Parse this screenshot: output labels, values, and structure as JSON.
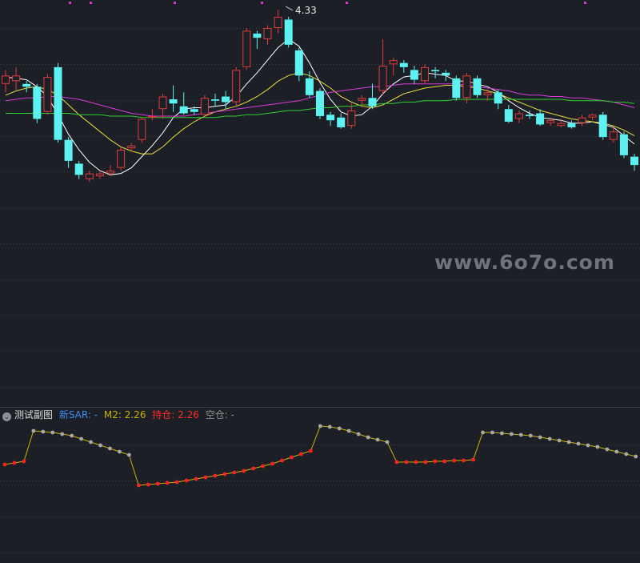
{
  "chart_data": [
    {
      "type": "candlestick",
      "annotation": "4.33",
      "candles": [
        [
          3.8,
          3.86,
          3.74,
          3.9
        ],
        [
          3.82,
          3.86,
          3.76,
          3.92
        ],
        [
          3.8,
          3.78,
          3.74,
          3.82
        ],
        [
          3.78,
          3.55,
          3.52,
          3.8
        ],
        [
          3.6,
          3.85,
          3.58,
          3.87
        ],
        [
          3.92,
          3.4,
          3.38,
          3.95
        ],
        [
          3.4,
          3.25,
          3.2,
          3.42
        ],
        [
          3.23,
          3.15,
          3.12,
          3.25
        ],
        [
          3.12,
          3.16,
          3.1,
          3.18
        ],
        [
          3.14,
          3.16,
          3.12,
          3.18
        ],
        [
          3.16,
          3.18,
          3.14,
          3.22
        ],
        [
          3.2,
          3.33,
          3.18,
          3.35
        ],
        [
          3.34,
          3.36,
          3.32,
          3.38
        ],
        [
          3.4,
          3.55,
          3.38,
          3.56
        ],
        [
          3.56,
          3.57,
          3.54,
          3.62
        ],
        [
          3.62,
          3.71,
          3.55,
          3.73
        ],
        [
          3.69,
          3.66,
          3.6,
          3.79
        ],
        [
          3.64,
          3.59,
          3.58,
          3.74
        ],
        [
          3.62,
          3.6,
          3.58,
          3.64
        ],
        [
          3.58,
          3.7,
          3.56,
          3.72
        ],
        [
          3.69,
          3.68,
          3.64,
          3.73
        ],
        [
          3.71,
          3.67,
          3.62,
          3.75
        ],
        [
          3.67,
          3.9,
          3.64,
          3.92
        ],
        [
          3.92,
          4.18,
          3.9,
          4.2
        ],
        [
          4.16,
          4.13,
          4.05,
          4.18
        ],
        [
          4.12,
          4.2,
          4.08,
          4.22
        ],
        [
          4.2,
          4.28,
          4.16,
          4.33
        ],
        [
          4.26,
          4.08,
          4.06,
          4.28
        ],
        [
          4.04,
          3.86,
          3.82,
          4.06
        ],
        [
          3.84,
          3.72,
          3.7,
          3.89
        ],
        [
          3.75,
          3.57,
          3.55,
          3.77
        ],
        [
          3.58,
          3.54,
          3.5,
          3.6
        ],
        [
          3.56,
          3.49,
          3.48,
          3.59
        ],
        [
          3.5,
          3.61,
          3.48,
          3.66
        ],
        [
          3.68,
          3.7,
          3.64,
          3.72
        ],
        [
          3.7,
          3.64,
          3.62,
          3.8
        ],
        [
          3.75,
          3.93,
          3.72,
          4.12
        ],
        [
          3.94,
          3.97,
          3.86,
          3.99
        ],
        [
          3.95,
          3.92,
          3.88,
          3.97
        ],
        [
          3.9,
          3.83,
          3.8,
          3.93
        ],
        [
          3.82,
          3.92,
          3.8,
          3.94
        ],
        [
          3.9,
          3.89,
          3.84,
          3.92
        ],
        [
          3.88,
          3.86,
          3.82,
          3.9
        ],
        [
          3.84,
          3.7,
          3.68,
          3.86
        ],
        [
          3.7,
          3.86,
          3.66,
          3.88
        ],
        [
          3.84,
          3.72,
          3.7,
          3.86
        ],
        [
          3.72,
          3.74,
          3.68,
          3.76
        ],
        [
          3.74,
          3.66,
          3.62,
          3.76
        ],
        [
          3.62,
          3.53,
          3.52,
          3.65
        ],
        [
          3.55,
          3.59,
          3.52,
          3.61
        ],
        [
          3.58,
          3.57,
          3.55,
          3.61
        ],
        [
          3.59,
          3.51,
          3.5,
          3.62
        ],
        [
          3.52,
          3.54,
          3.5,
          3.56
        ],
        [
          3.5,
          3.52,
          3.49,
          3.55
        ],
        [
          3.52,
          3.49,
          3.48,
          3.54
        ],
        [
          3.52,
          3.56,
          3.5,
          3.58
        ],
        [
          3.56,
          3.58,
          3.54,
          3.59
        ],
        [
          3.58,
          3.42,
          3.4,
          3.6
        ],
        [
          3.4,
          3.46,
          3.38,
          3.49
        ],
        [
          3.44,
          3.29,
          3.27,
          3.46
        ],
        [
          3.28,
          3.22,
          3.18,
          3.3
        ]
      ],
      "ma": [
        {
          "color": "#ffffff",
          "values": [
            3.85,
            3.84,
            3.83,
            3.78,
            3.71,
            3.58,
            3.44,
            3.33,
            3.24,
            3.18,
            3.15,
            3.16,
            3.2,
            3.28,
            3.36,
            3.45,
            3.56,
            3.62,
            3.63,
            3.63,
            3.64,
            3.65,
            3.71,
            3.8,
            3.88,
            3.97,
            4.06,
            4.12,
            4.07,
            3.95,
            3.81,
            3.69,
            3.6,
            3.57,
            3.58,
            3.64,
            3.73,
            3.8,
            3.85,
            3.86,
            3.88,
            3.87,
            3.86,
            3.82,
            3.82,
            3.8,
            3.78,
            3.74,
            3.68,
            3.63,
            3.59,
            3.56,
            3.55,
            3.54,
            3.52,
            3.52,
            3.53,
            3.51,
            3.49,
            3.43,
            3.37
          ]
        },
        {
          "color": "#e6dc3c",
          "values": [
            3.72,
            3.75,
            3.77,
            3.78,
            3.76,
            3.72,
            3.65,
            3.58,
            3.52,
            3.46,
            3.4,
            3.35,
            3.32,
            3.3,
            3.3,
            3.35,
            3.42,
            3.48,
            3.53,
            3.57,
            3.6,
            3.62,
            3.64,
            3.67,
            3.71,
            3.76,
            3.82,
            3.86,
            3.88,
            3.86,
            3.82,
            3.77,
            3.71,
            3.67,
            3.64,
            3.63,
            3.65,
            3.69,
            3.73,
            3.75,
            3.77,
            3.78,
            3.79,
            3.79,
            3.78,
            3.77,
            3.75,
            3.73,
            3.7,
            3.67,
            3.64,
            3.61,
            3.59,
            3.57,
            3.55,
            3.54,
            3.53,
            3.52,
            3.5,
            3.47,
            3.43
          ]
        },
        {
          "color": "#d83ad8",
          "values": [
            3.68,
            3.69,
            3.7,
            3.7,
            3.71,
            3.71,
            3.7,
            3.69,
            3.67,
            3.65,
            3.63,
            3.61,
            3.59,
            3.58,
            3.57,
            3.57,
            3.57,
            3.57,
            3.58,
            3.59,
            3.6,
            3.61,
            3.62,
            3.63,
            3.64,
            3.65,
            3.66,
            3.67,
            3.68,
            3.7,
            3.72,
            3.74,
            3.75,
            3.76,
            3.77,
            3.78,
            3.78,
            3.79,
            3.8,
            3.8,
            3.8,
            3.8,
            3.8,
            3.8,
            3.79,
            3.78,
            3.77,
            3.76,
            3.75,
            3.73,
            3.72,
            3.72,
            3.71,
            3.71,
            3.7,
            3.7,
            3.69,
            3.68,
            3.67,
            3.65,
            3.63
          ]
        },
        {
          "color": "#2fcf2f",
          "values": [
            3.59,
            3.59,
            3.59,
            3.59,
            3.59,
            3.59,
            3.59,
            3.58,
            3.58,
            3.58,
            3.57,
            3.57,
            3.57,
            3.56,
            3.56,
            3.56,
            3.56,
            3.56,
            3.56,
            3.56,
            3.56,
            3.57,
            3.57,
            3.58,
            3.58,
            3.59,
            3.6,
            3.61,
            3.61,
            3.62,
            3.63,
            3.63,
            3.64,
            3.64,
            3.65,
            3.65,
            3.66,
            3.66,
            3.67,
            3.67,
            3.68,
            3.68,
            3.68,
            3.69,
            3.69,
            3.69,
            3.69,
            3.69,
            3.69,
            3.69,
            3.69,
            3.69,
            3.69,
            3.69,
            3.68,
            3.68,
            3.68,
            3.68,
            3.67,
            3.67,
            3.66
          ]
        }
      ]
    },
    {
      "type": "line",
      "values": [
        3.6,
        3.62,
        3.64,
        4.02,
        4.01,
        4.0,
        3.98,
        3.96,
        3.92,
        3.88,
        3.84,
        3.8,
        3.76,
        3.72,
        3.34,
        3.35,
        3.36,
        3.37,
        3.38,
        3.4,
        3.42,
        3.44,
        3.46,
        3.48,
        3.5,
        3.52,
        3.55,
        3.58,
        3.61,
        3.65,
        3.69,
        3.73,
        3.77,
        4.08,
        4.07,
        4.05,
        4.02,
        3.98,
        3.94,
        3.91,
        3.88,
        3.63,
        3.63,
        3.63,
        3.63,
        3.64,
        3.64,
        3.65,
        3.65,
        3.66,
        4.0,
        4.0,
        3.99,
        3.98,
        3.97,
        3.96,
        3.94,
        3.92,
        3.9,
        3.88,
        3.86,
        3.84,
        3.82,
        3.79,
        3.76,
        3.73,
        3.7
      ],
      "signal": [
        "red",
        "red",
        "red",
        "gray",
        "gray",
        "gray",
        "gray",
        "gray",
        "gray",
        "gray",
        "gray",
        "gray",
        "gray",
        "gray",
        "red",
        "red",
        "red",
        "red",
        "red",
        "red",
        "red",
        "red",
        "red",
        "red",
        "red",
        "red",
        "red",
        "red",
        "red",
        "red",
        "red",
        "red",
        "red",
        "gray",
        "gray",
        "gray",
        "gray",
        "gray",
        "gray",
        "gray",
        "gray",
        "red",
        "red",
        "red",
        "red",
        "red",
        "red",
        "red",
        "red",
        "red",
        "gray",
        "gray",
        "gray",
        "gray",
        "gray",
        "gray",
        "gray",
        "gray",
        "gray",
        "gray",
        "gray",
        "gray",
        "gray",
        "gray",
        "gray",
        "gray",
        "gray"
      ]
    }
  ],
  "sub_panel": {
    "name": "测试副图",
    "sar_label": "新SAR: -",
    "m2_label": "M2: 2.26",
    "hold_label": "持仓: 2.26",
    "empty_label": "空仓: -"
  },
  "watermark": "www.6o7o.com",
  "colors": {
    "background": "#1c1f26",
    "up": "#e03c3c",
    "down": "#5cf2f2",
    "grid": "#3a3f4a",
    "sar_red": "#ff2020",
    "sar_gray": "#a8a8a8",
    "sar_line": "#c9b400"
  }
}
